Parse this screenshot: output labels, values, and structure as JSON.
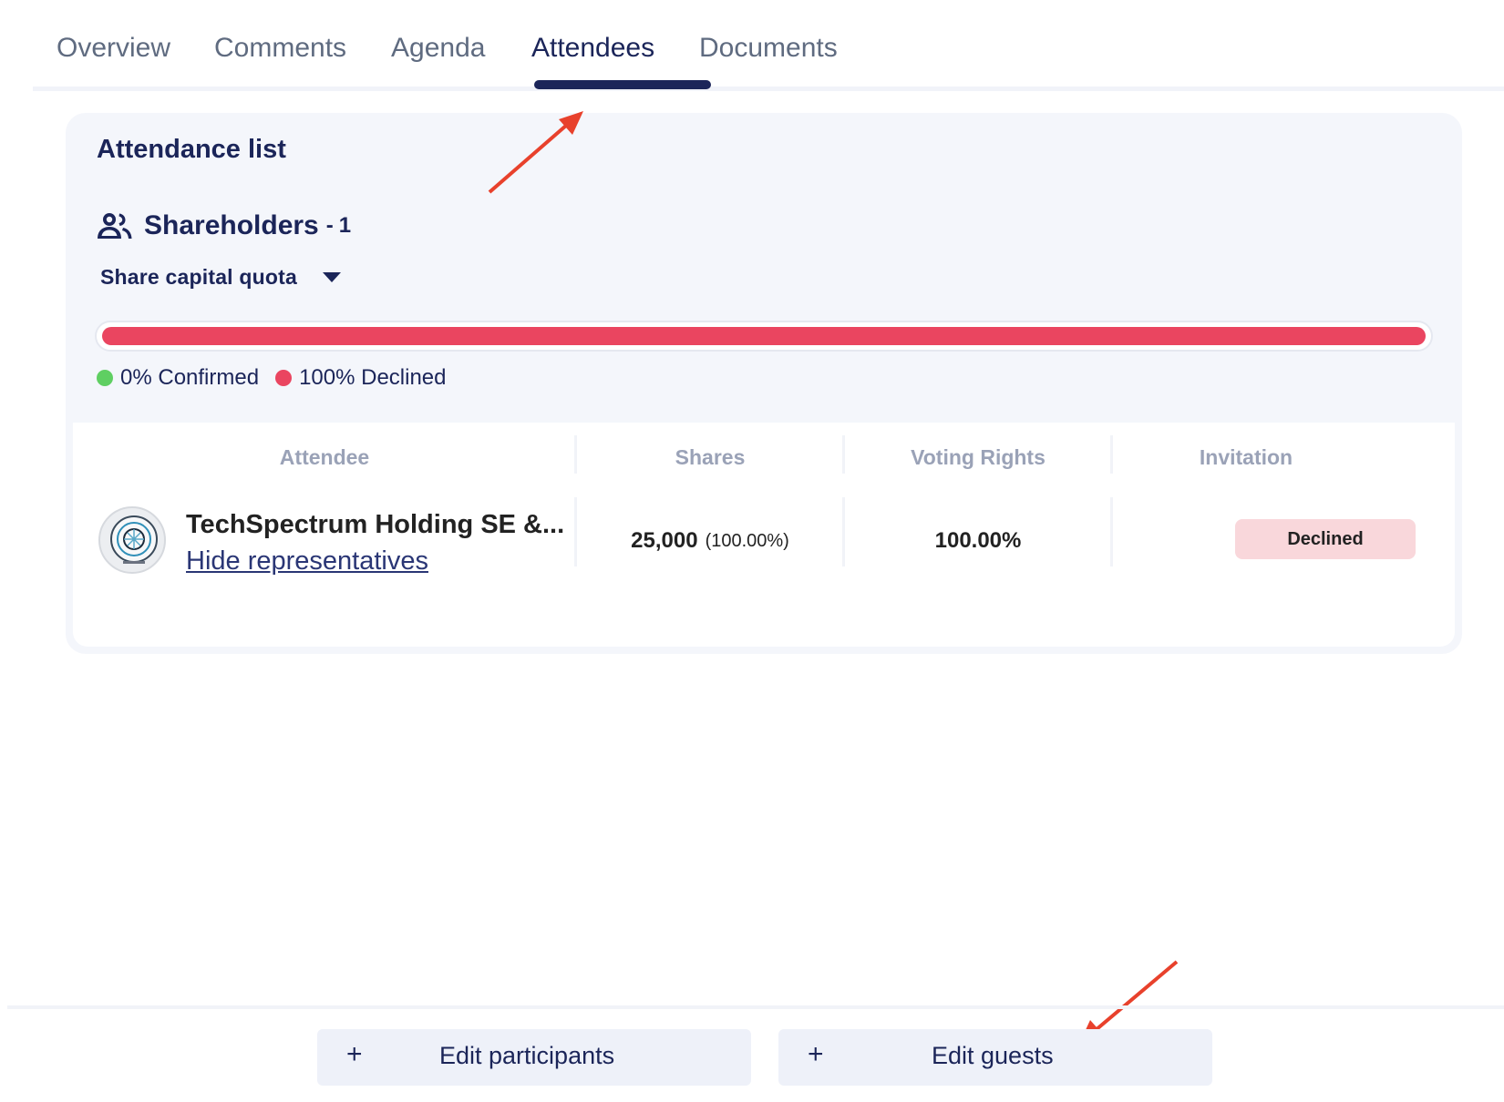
{
  "tabs": [
    {
      "label": "Overview"
    },
    {
      "label": "Comments"
    },
    {
      "label": "Agenda"
    },
    {
      "label": "Attendees",
      "active": true
    },
    {
      "label": "Documents"
    }
  ],
  "attendance": {
    "title": "Attendance list",
    "group_label": "Shareholders",
    "group_dash": "-",
    "group_count": "1",
    "quota_label": "Share capital quota",
    "declined_fraction": 1.0,
    "legend": [
      {
        "text": "0% Confirmed",
        "color": "#5fcf62"
      },
      {
        "text": "100% Declined",
        "color": "#ea4560"
      }
    ]
  },
  "table": {
    "headers": [
      "Attendee",
      "Shares",
      "Voting Rights",
      "Invitation"
    ],
    "rows": [
      {
        "name": "TechSpectrum Holding SE &...",
        "link": "Hide representatives",
        "shares": "25,000",
        "shares_pct": "(100.00%)",
        "voting": "100.00%",
        "invitation": "Declined"
      }
    ]
  },
  "footer": {
    "edit_participants": "Edit participants",
    "edit_guests": "Edit guests",
    "plus": "+"
  },
  "colors": {
    "accent": "#1b2559",
    "declined": "#ea4560",
    "confirmed": "#5fcf62",
    "annotation": "#e8412c"
  },
  "icons": [
    "users-icon",
    "caret-down-icon",
    "plus-icon",
    "company-logo-icon",
    "annotation-arrow"
  ]
}
